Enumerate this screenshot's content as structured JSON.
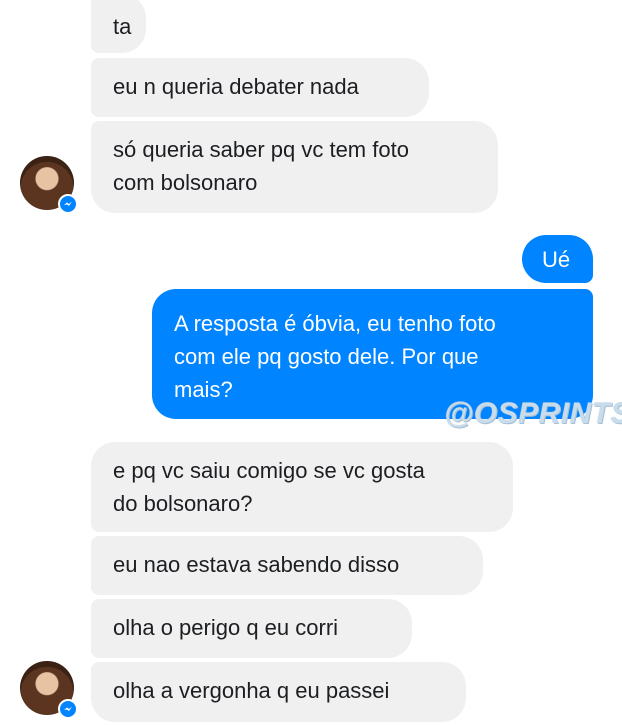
{
  "messages": [
    {
      "id": "m1",
      "sender": "them",
      "lines": [
        "ta"
      ]
    },
    {
      "id": "m2",
      "sender": "them",
      "lines": [
        "eu n queria debater nada"
      ]
    },
    {
      "id": "m3",
      "sender": "them",
      "lines": [
        "só queria saber pq vc tem foto",
        "com bolsonaro"
      ]
    },
    {
      "id": "m4",
      "sender": "me",
      "lines": [
        "Ué"
      ]
    },
    {
      "id": "m5",
      "sender": "me",
      "lines": [
        "A resposta é óbvia, eu tenho foto",
        "com ele pq gosto dele. Por que",
        "mais?"
      ]
    },
    {
      "id": "m6",
      "sender": "them",
      "lines": [
        "e pq vc saiu comigo se vc gosta",
        "do bolsonaro?"
      ]
    },
    {
      "id": "m7",
      "sender": "them",
      "lines": [
        "eu nao estava sabendo disso"
      ]
    },
    {
      "id": "m8",
      "sender": "them",
      "lines": [
        "olha o perigo q eu corri"
      ]
    },
    {
      "id": "m9",
      "sender": "them",
      "lines": [
        "olha a vergonha q eu passei"
      ]
    }
  ],
  "watermark": "@OSPRINTS",
  "colors": {
    "outgoing": "#0084ff",
    "incoming": "#f0f0f1",
    "incoming_text": "#1c1e21"
  },
  "icons": {
    "avatar": "contact-avatar",
    "badge": "messenger-badge-icon"
  }
}
